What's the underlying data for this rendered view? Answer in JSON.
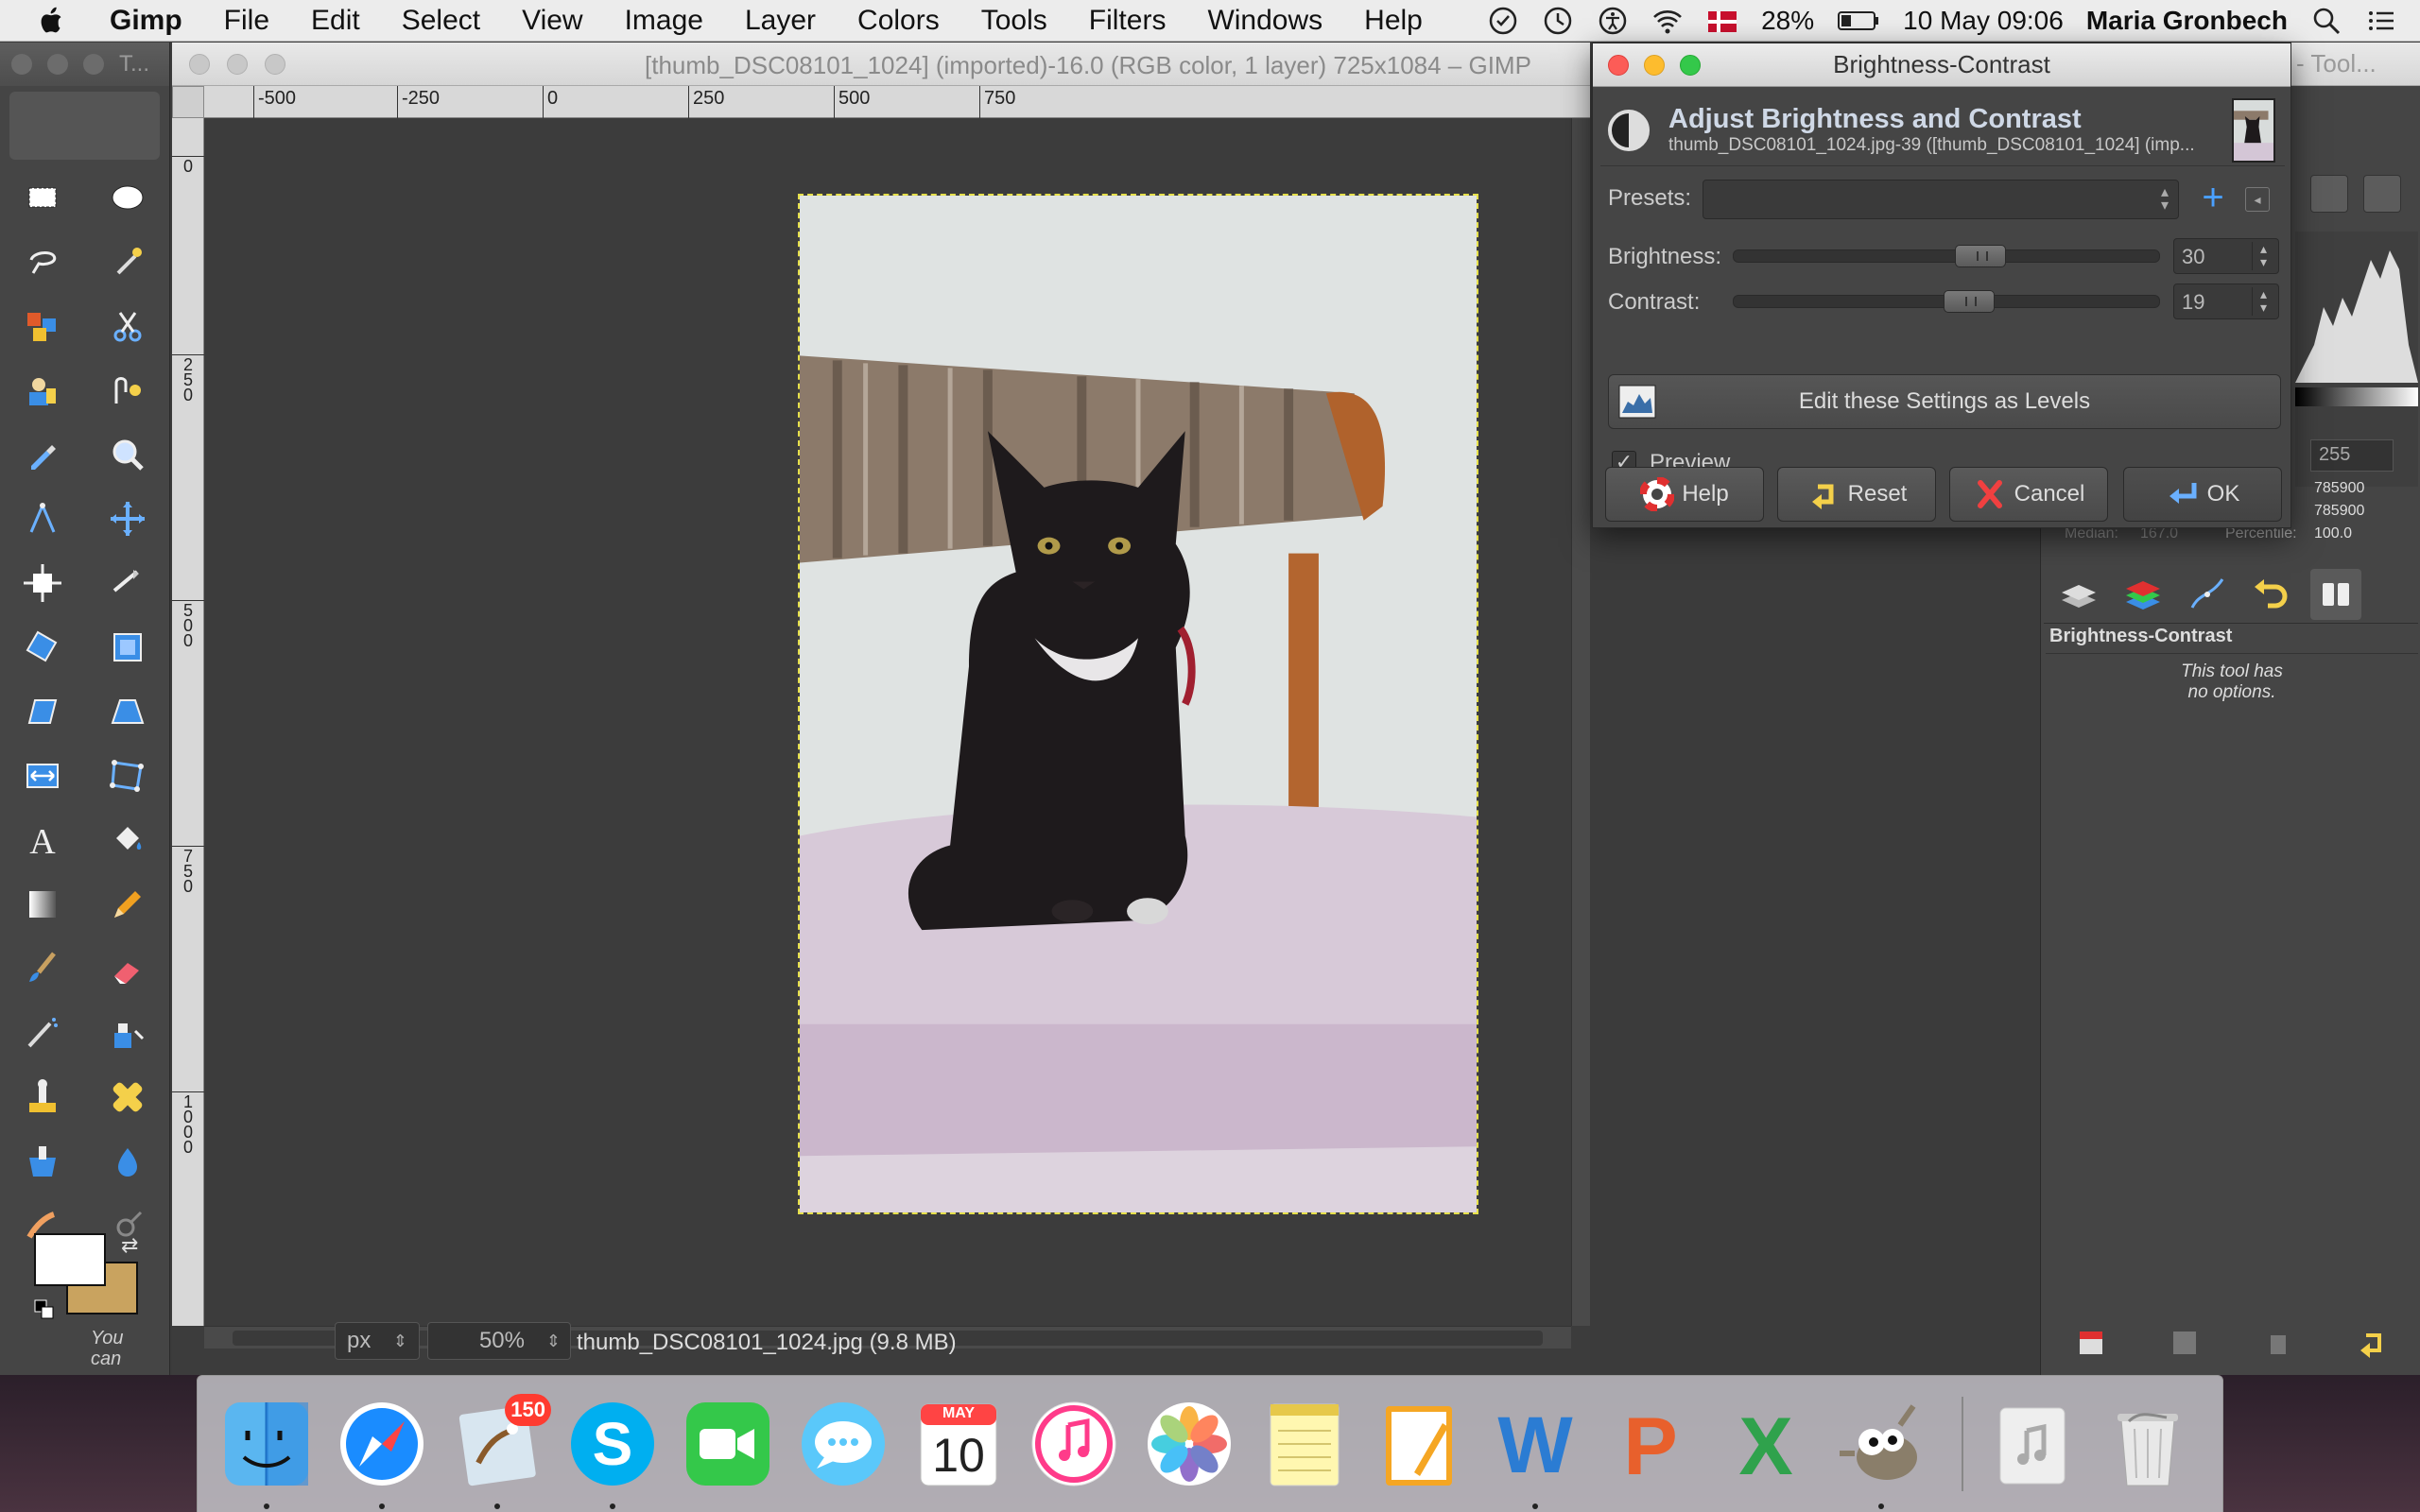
{
  "menubar": {
    "app": "Gimp",
    "menus": [
      "File",
      "Edit",
      "Select",
      "View",
      "Image",
      "Layer",
      "Colors",
      "Tools",
      "Filters",
      "Windows",
      "Help"
    ],
    "battery": "28%",
    "datetime": "10 May  09:06",
    "user": "Maria Gronbech"
  },
  "toolbox": {
    "title": "T...",
    "hint_line1": "You",
    "hint_line2": "can",
    "fg_color": "#ffffff",
    "bg_color": "#c9a35f"
  },
  "image_window": {
    "title": "[thumb_DSC08101_1024] (imported)-16.0 (RGB color, 1 layer) 725x1084 – GIMP",
    "ruler_labels": [
      "-500",
      "-250",
      "0",
      "250",
      "500",
      "750"
    ],
    "vruler_labels": [
      "0",
      "2\n5\n0",
      "5\n0\n0",
      "7\n5\n0",
      "1\n0\n0\n0"
    ],
    "unit": "px",
    "zoom": "50%",
    "file_info": "thumb_DSC08101_1024.jpg (9.8 MB)"
  },
  "dialog": {
    "window_title": "Brightness-Contrast",
    "heading": "Adjust Brightness and Contrast",
    "subheading": "thumb_DSC08101_1024.jpg-39 ([thumb_DSC08101_1024] (imp...",
    "presets_label": "Presets:",
    "presets_value": "",
    "brightness_label": "Brightness:",
    "brightness_value": "30",
    "brightness_fraction": 0.59,
    "contrast_label": "Contrast:",
    "contrast_value": "19",
    "contrast_fraction": 0.56,
    "levels_button": "Edit these Settings as Levels",
    "preview_label": "Preview",
    "preview_checked": true,
    "buttons": {
      "help": "Help",
      "reset": "Reset",
      "cancel": "Cancel",
      "ok": "OK"
    }
  },
  "dock_panel": {
    "title": "- Tool...",
    "hist_max": "255",
    "stat_values": [
      "785900",
      "785900",
      "100.0"
    ],
    "stat_labels": [
      "Median:",
      "167.0",
      "Percentile:"
    ],
    "tool_options_title": "Brightness-Contrast",
    "tool_options_msg_line1": "This tool has",
    "tool_options_msg_line2": "no options."
  },
  "dock": {
    "mail_badge": "150",
    "calendar_month": "MAY",
    "calendar_day": "10"
  }
}
